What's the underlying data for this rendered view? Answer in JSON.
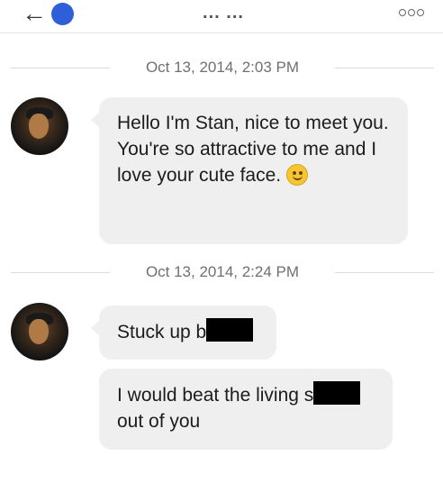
{
  "header": {
    "back_glyph": "←",
    "title_glyph": "... ...",
    "menu_icon": "more-options-icon"
  },
  "conversation": [
    {
      "timestamp": "Oct 13, 2014, 2:03 PM",
      "messages": [
        {
          "text": "Hello I'm Stan, nice to meet you. You're so attractive to me and I love your cute face.",
          "emoji": "smiling-face-icon"
        }
      ]
    },
    {
      "timestamp": "Oct 13, 2014, 2:24 PM",
      "messages": [
        {
          "text": "Stuck up b",
          "redacted": true
        },
        {
          "text_before": "I would beat the living s",
          "text_after": "out of you",
          "redacted": true
        }
      ]
    }
  ],
  "colors": {
    "bubble_background": "#efefef",
    "accent_dot": "#2f5fd8",
    "timestamp_text": "#6f6f6f",
    "redaction": "#000000"
  }
}
